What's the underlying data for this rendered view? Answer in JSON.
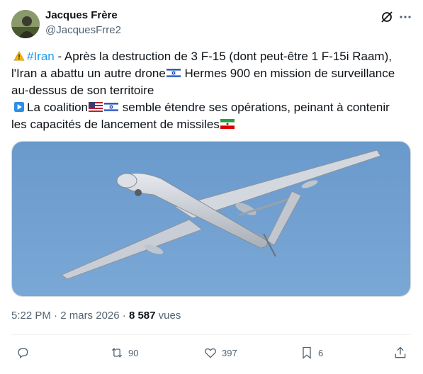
{
  "author": {
    "name": "Jacques Frère",
    "handle": "@JacquesFrre2"
  },
  "tweet": {
    "lines": [
      {
        "prefix_icon": "warning-icon",
        "hashtag": "#Iran",
        "text": " - Après la destruction de 3 F-15 (dont peut-être 1 F-15i Raam),"
      },
      {
        "text_before": "l'Iran a abattu un autre drone",
        "flag": "israel-flag-icon",
        "text_after": " Hermes 900 en mission de surveillance"
      },
      {
        "text": "au-dessus de son territoire"
      },
      {
        "prefix_icon": "play-button-icon",
        "text_before": "La coalition",
        "flags": [
          "us-flag-icon",
          "israel-flag-icon"
        ],
        "text_after": " semble étendre ses opérations, peinant à contenir"
      },
      {
        "text_before": "les capacités de lancement de missiles",
        "flag": "iran-flag-icon"
      }
    ]
  },
  "meta": {
    "time": "5:22 PM",
    "separator": " · ",
    "date": "2 mars 2026",
    "views_count": "8 587",
    "views_label": " vues"
  },
  "actions": {
    "reply": {
      "icon": "reply-icon",
      "count": ""
    },
    "retweet": {
      "icon": "retweet-icon",
      "count": "90"
    },
    "like": {
      "icon": "heart-icon",
      "count": "397"
    },
    "bookmark": {
      "icon": "bookmark-icon",
      "count": "6"
    },
    "share": {
      "icon": "share-icon",
      "count": ""
    }
  },
  "colors": {
    "accent": "#1d9bf0",
    "text": "#0f1419",
    "secondary": "#536471",
    "sky": "#6f9ed0"
  }
}
